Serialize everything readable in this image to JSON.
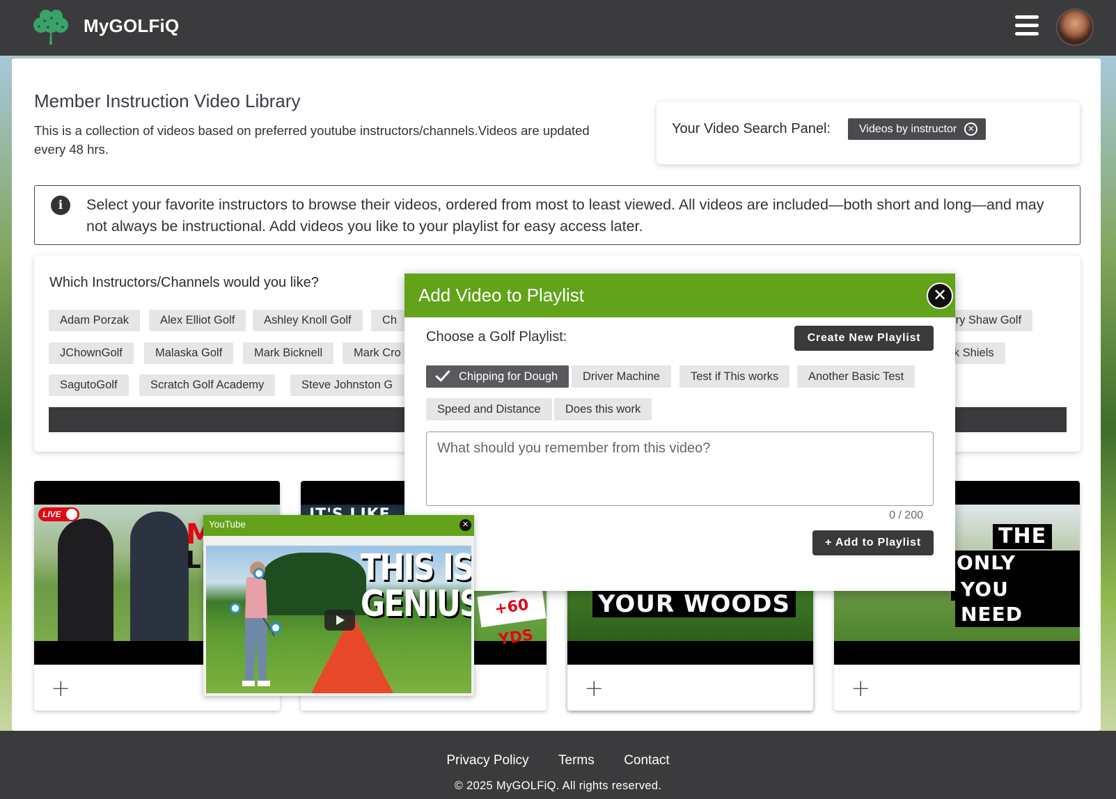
{
  "header": {
    "brand": "MyGOLFiQ"
  },
  "main": {
    "title": "Member Instruction Video Library",
    "description": "This is a collection of videos based on preferred youtube instructors/channels.Videos are updated every 48 hrs."
  },
  "search_panel": {
    "label": "Your Video Search Panel:",
    "active_filter": "Videos by instructor"
  },
  "info": {
    "text": "Select your favorite instructors to browse their videos, ordered from most to least viewed. All videos are included—both short and long—and may not always be instructional. Add videos you like to your playlist for easy access later."
  },
  "instructors": {
    "title": "Which Instructors/Channels would you like?",
    "row1": [
      "Adam Porzak",
      "Alex Elliot Golf",
      "Ashley Knoll Golf",
      "Ch",
      "Harry Shaw Golf"
    ],
    "row2": [
      "JChownGolf",
      "Malaska Golf",
      "Mark Bicknell",
      "Mark Cro",
      "Rick Shiels"
    ],
    "row3": [
      "SagutoGolf",
      "Scratch Golf Academy",
      "Steve Johnston G"
    ]
  },
  "cards": {
    "thumb1": {
      "badge": "LIVE",
      "overlay": "M",
      "overlay2": "LI"
    },
    "thumb2": {
      "overlay": "IT'S LIKE",
      "yds": "+60 YDS"
    },
    "thumb4": {
      "overlay": "YOUR WOODS"
    },
    "thumb5": {
      "line1": "THE",
      "line2": "ONLY DRILL",
      "line3": "YOU NEED"
    },
    "add_symbol": "+"
  },
  "youtube_player": {
    "title": "YouTube",
    "close": "✕",
    "headline1": "THIS IS",
    "headline2": "GENIUS"
  },
  "modal": {
    "title": "Add Video to Playlist",
    "close": "✕",
    "choose_label": "Choose a Golf Playlist:",
    "create_button": "Create New Playlist",
    "playlists": [
      {
        "label": "Chipping for Dough",
        "selected": true
      },
      {
        "label": "Driver Machine",
        "selected": false
      },
      {
        "label": "Test if This works",
        "selected": false
      },
      {
        "label": "Another Basic Test",
        "selected": false
      },
      {
        "label": "Speed and Distance",
        "selected": false
      },
      {
        "label": "Does this work",
        "selected": false
      }
    ],
    "notes_placeholder": "What should you remember from this video?",
    "counter": "0 / 200",
    "add_button": "+ Add to Playlist"
  },
  "footer": {
    "links": [
      "Privacy Policy",
      "Terms",
      "Contact"
    ],
    "copyright": "© 2025 MyGOLFiQ. All rights reserved."
  },
  "colors": {
    "header_bg": "#3b3b3d",
    "accent_green": "#62a31a",
    "chip_bg": "#e6e6e6",
    "dark_button": "#3a3a3d"
  }
}
